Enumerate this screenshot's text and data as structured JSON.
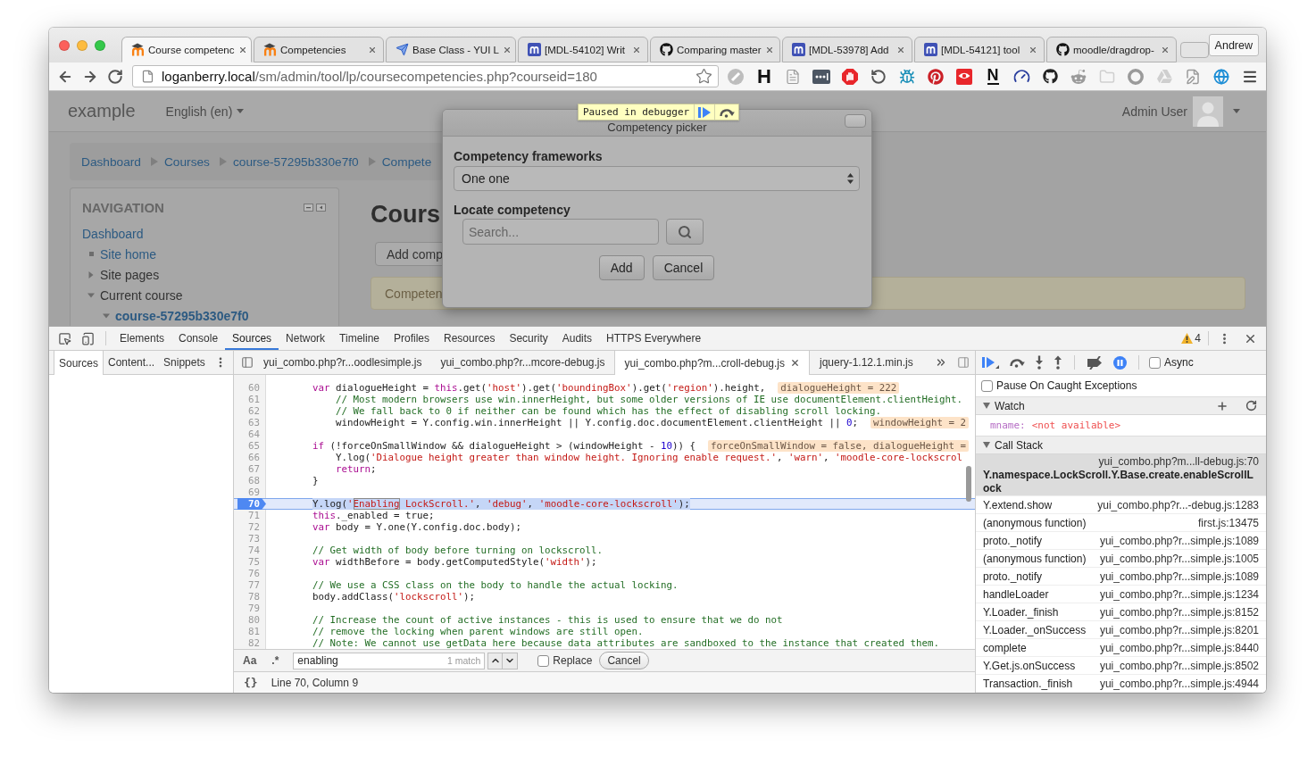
{
  "browser": {
    "tabs": [
      {
        "title": "Course competenc",
        "kind": "moodle",
        "selected": true
      },
      {
        "title": "Competencies",
        "kind": "moodle",
        "selected": false
      },
      {
        "title": "Base Class - YUI L",
        "kind": "yui",
        "selected": false
      },
      {
        "title": "[MDL-54102] Writ",
        "kind": "tracker",
        "selected": false
      },
      {
        "title": "Comparing master",
        "kind": "github",
        "selected": false
      },
      {
        "title": "[MDL-53978] Add",
        "kind": "tracker",
        "selected": false
      },
      {
        "title": "[MDL-54121] tool",
        "kind": "tracker",
        "selected": false
      },
      {
        "title": "moodle/dragdrop-",
        "kind": "github",
        "selected": false
      }
    ],
    "profile": "Andrew",
    "url": {
      "host": "loganberry.local",
      "path": "/sm/admin/tool/lp/coursecompetencies.php?courseid=180"
    },
    "extension_letters": [
      "H",
      "N"
    ]
  },
  "page": {
    "navbar": {
      "brand": "example",
      "language": "English (en)",
      "user": "Admin User"
    },
    "breadcrumb": [
      "Dashboard",
      "Courses",
      "course-57295b330e7f0",
      "Compete"
    ],
    "navigation": {
      "title": "NAVIGATION",
      "items": [
        {
          "label": "Dashboard",
          "kind": "plain",
          "link": true,
          "current": false
        },
        {
          "label": "Site home",
          "kind": "leaf",
          "link": true,
          "current": false
        },
        {
          "label": "Site pages",
          "kind": "branch",
          "expanded": false,
          "link": false,
          "current": false
        },
        {
          "label": "Current course",
          "kind": "branch",
          "expanded": true,
          "link": false,
          "current": false,
          "children": [
            {
              "label": "course-57295b330e7f0",
              "kind": "branch",
              "expanded": true,
              "link": true,
              "current": true
            }
          ]
        }
      ]
    },
    "heading": "Cours",
    "action_button": "Add comp",
    "notice": "Competen",
    "modal": {
      "title": "Competency picker",
      "frameworks_label": "Competency frameworks",
      "framework": "One one",
      "locate_label": "Locate competency",
      "search_placeholder": "Search...",
      "buttons": [
        "Add",
        "Cancel"
      ]
    },
    "debugger_banner": {
      "label": "Paused in debugger"
    }
  },
  "devtools": {
    "panels": [
      {
        "label": "Elements",
        "selected": false
      },
      {
        "label": "Console",
        "selected": false
      },
      {
        "label": "Sources",
        "selected": true
      },
      {
        "label": "Network",
        "selected": false
      },
      {
        "label": "Timeline",
        "selected": false
      },
      {
        "label": "Profiles",
        "selected": false
      },
      {
        "label": "Resources",
        "selected": false
      },
      {
        "label": "Security",
        "selected": false
      },
      {
        "label": "Audits",
        "selected": false
      },
      {
        "label": "HTTPS Everywhere",
        "selected": false
      }
    ],
    "warning_count": "4",
    "navigator_tabs": [
      {
        "label": "Sources",
        "selected": true
      },
      {
        "label": "Content...",
        "selected": false
      },
      {
        "label": "Snippets",
        "selected": false
      }
    ],
    "editor_tabs": [
      {
        "label": "yui_combo.php?r...oodlesimple.js",
        "selected": false
      },
      {
        "label": "yui_combo.php?r...mcore-debug.js",
        "selected": false
      },
      {
        "label": "yui_combo.php?m...croll-debug.js",
        "selected": true
      },
      {
        "label": "jquery-1.12.1.min.js",
        "selected": false
      }
    ],
    "lines": [
      {
        "number": "60",
        "tokens": [
          {
            "kind": "keyword",
            "text": "        var"
          },
          {
            "kind": "plain",
            "text": " dialogueHeight = "
          },
          {
            "kind": "keyword",
            "text": "this"
          },
          {
            "kind": "plain",
            "text": ".get("
          },
          {
            "kind": "string",
            "text": "'host'"
          },
          {
            "kind": "plain",
            "text": ").get("
          },
          {
            "kind": "string",
            "text": "'boundingBox'"
          },
          {
            "kind": "plain",
            "text": ").get("
          },
          {
            "kind": "string",
            "text": "'region'"
          },
          {
            "kind": "plain",
            "text": ").height,"
          }
        ],
        "value": "dialogueHeight = 222",
        "breakpoint": false,
        "current": false
      },
      {
        "number": "61",
        "tokens": [
          {
            "kind": "comment",
            "text": "            // Most modern browsers use win.innerHeight, but some older versions of IE use documentElement.clientHeight."
          }
        ],
        "breakpoint": false,
        "current": false
      },
      {
        "number": "62",
        "tokens": [
          {
            "kind": "comment",
            "text": "            // We fall back to 0 if neither can be found which has the effect of disabling scroll locking."
          }
        ],
        "breakpoint": false,
        "current": false
      },
      {
        "number": "63",
        "tokens": [
          {
            "kind": "plain",
            "text": "            windowHeight = Y.config.win.innerHeight || Y.config.doc.documentElement.clientHeight || "
          },
          {
            "kind": "number",
            "text": "0"
          },
          {
            "kind": "plain",
            "text": ";"
          }
        ],
        "value": "windowHeight = 2",
        "breakpoint": false,
        "current": false
      },
      {
        "number": "64",
        "breakpoint": false,
        "current": false
      },
      {
        "number": "65",
        "tokens": [
          {
            "kind": "keyword",
            "text": "        if"
          },
          {
            "kind": "plain",
            "text": " (!forceOnSmallWindow && dialogueHeight > (windowHeight - "
          },
          {
            "kind": "number",
            "text": "10"
          },
          {
            "kind": "plain",
            "text": ")) {"
          }
        ],
        "value": "forceOnSmallWindow = false, dialogueHeight =",
        "breakpoint": false,
        "current": false
      },
      {
        "number": "66",
        "tokens": [
          {
            "kind": "plain",
            "text": "            Y.log("
          },
          {
            "kind": "string",
            "text": "'Dialogue height greater than window height. Ignoring enable request.'"
          },
          {
            "kind": "plain",
            "text": ", "
          },
          {
            "kind": "string",
            "text": "'warn'"
          },
          {
            "kind": "plain",
            "text": ", "
          },
          {
            "kind": "string",
            "text": "'moodle-core-lockscrol"
          }
        ],
        "breakpoint": false,
        "current": false
      },
      {
        "number": "67",
        "tokens": [
          {
            "kind": "keyword",
            "text": "            return"
          },
          {
            "kind": "plain",
            "text": ";"
          }
        ],
        "breakpoint": false,
        "current": false
      },
      {
        "number": "68",
        "tokens": [
          {
            "kind": "plain",
            "text": "        }"
          }
        ],
        "breakpoint": false,
        "current": false
      },
      {
        "number": "69",
        "breakpoint": false,
        "current": false
      },
      {
        "number": "70",
        "tokens": [
          {
            "kind": "plain",
            "text": "        Y.log("
          },
          {
            "kind": "string",
            "text": "'"
          },
          {
            "kind": "match",
            "text": "Enabling"
          },
          {
            "kind": "string",
            "text": " LockScroll.'"
          },
          {
            "kind": "plain",
            "text": ", "
          },
          {
            "kind": "string",
            "text": "'debug'"
          },
          {
            "kind": "plain",
            "text": ", "
          },
          {
            "kind": "string",
            "text": "'moodle-core-lockscroll'"
          },
          {
            "kind": "plain",
            "text": ");"
          }
        ],
        "breakpoint": true,
        "current": true
      },
      {
        "number": "71",
        "tokens": [
          {
            "kind": "keyword",
            "text": "        this"
          },
          {
            "kind": "plain",
            "text": "._enabled = true;"
          }
        ],
        "breakpoint": false,
        "current": false
      },
      {
        "number": "72",
        "tokens": [
          {
            "kind": "keyword",
            "text": "        var"
          },
          {
            "kind": "plain",
            "text": " body = Y.one(Y.config.doc.body);"
          }
        ],
        "breakpoint": false,
        "current": false
      },
      {
        "number": "73",
        "breakpoint": false,
        "current": false
      },
      {
        "number": "74",
        "tokens": [
          {
            "kind": "comment",
            "text": "        // Get width of body before turning on lockscroll."
          }
        ],
        "breakpoint": false,
        "current": false
      },
      {
        "number": "75",
        "tokens": [
          {
            "kind": "keyword",
            "text": "        var"
          },
          {
            "kind": "plain",
            "text": " widthBefore = body.getComputedStyle("
          },
          {
            "kind": "string",
            "text": "'width'"
          },
          {
            "kind": "plain",
            "text": ");"
          }
        ],
        "breakpoint": false,
        "current": false
      },
      {
        "number": "76",
        "breakpoint": false,
        "current": false
      },
      {
        "number": "77",
        "tokens": [
          {
            "kind": "comment",
            "text": "        // We use a CSS class on the body to handle the actual locking."
          }
        ],
        "breakpoint": false,
        "current": false
      },
      {
        "number": "78",
        "tokens": [
          {
            "kind": "plain",
            "text": "        body.addClass("
          },
          {
            "kind": "string",
            "text": "'lockscroll'"
          },
          {
            "kind": "plain",
            "text": ");"
          }
        ],
        "breakpoint": false,
        "current": false
      },
      {
        "number": "79",
        "breakpoint": false,
        "current": false
      },
      {
        "number": "80",
        "tokens": [
          {
            "kind": "comment",
            "text": "        // Increase the count of active instances - this is used to ensure that we do not"
          }
        ],
        "breakpoint": false,
        "current": false
      },
      {
        "number": "81",
        "tokens": [
          {
            "kind": "comment",
            "text": "        // remove the locking when parent windows are still open."
          }
        ],
        "breakpoint": false,
        "current": false
      },
      {
        "number": "82",
        "tokens": [
          {
            "kind": "comment",
            "text": "        // Note: We cannot use getData here because data attributes are sandboxed to the instance that created them."
          }
        ],
        "breakpoint": false,
        "current": false
      }
    ],
    "search": {
      "case_toggle": "Aa",
      "regex_toggle": ".*",
      "query": "enabling",
      "match_count": "1 match",
      "replace_label": "Replace",
      "replace": false,
      "cancel": "Cancel"
    },
    "status": {
      "format_button": "{}",
      "position": "Line 70, Column 9"
    },
    "sidebar": {
      "async_label": "Async",
      "async": false,
      "caught_label": "Pause On Caught Exceptions",
      "pause_caught": false,
      "watch": {
        "title": "Watch",
        "expanded": true,
        "expressions": [
          {
            "name": "mname:",
            "value": "<not available>"
          }
        ]
      },
      "call_stack": {
        "title": "Call Stack",
        "expanded": true,
        "frames": [
          {
            "function": "Y.namespace.LockScroll.Y.Base.create.enableScrollLock",
            "location": "yui_combo.php?m...ll-debug.js:70",
            "selected": true
          },
          {
            "function": "Y.extend.show",
            "location": "yui_combo.php?r...-debug.js:1283",
            "selected": false
          },
          {
            "function": "(anonymous function)",
            "location": "first.js:13475",
            "selected": false
          },
          {
            "function": "proto._notify",
            "location": "yui_combo.php?r...simple.js:1089",
            "selected": false
          },
          {
            "function": "(anonymous function)",
            "location": "yui_combo.php?r...simple.js:1005",
            "selected": false
          },
          {
            "function": "proto._notify",
            "location": "yui_combo.php?r...simple.js:1089",
            "selected": false
          },
          {
            "function": "handleLoader",
            "location": "yui_combo.php?r...simple.js:1234",
            "selected": false
          },
          {
            "function": "Y.Loader._finish",
            "location": "yui_combo.php?r...simple.js:8152",
            "selected": false
          },
          {
            "function": "Y.Loader._onSuccess",
            "location": "yui_combo.php?r...simple.js:8201",
            "selected": false
          },
          {
            "function": "complete",
            "location": "yui_combo.php?r...simple.js:8440",
            "selected": false
          },
          {
            "function": "Y.Get.js.onSuccess",
            "location": "yui_combo.php?r...simple.js:8502",
            "selected": false
          },
          {
            "function": "Transaction._finish",
            "location": "yui_combo.php?r...simple.js:4944",
            "selected": false
          }
        ]
      }
    }
  }
}
